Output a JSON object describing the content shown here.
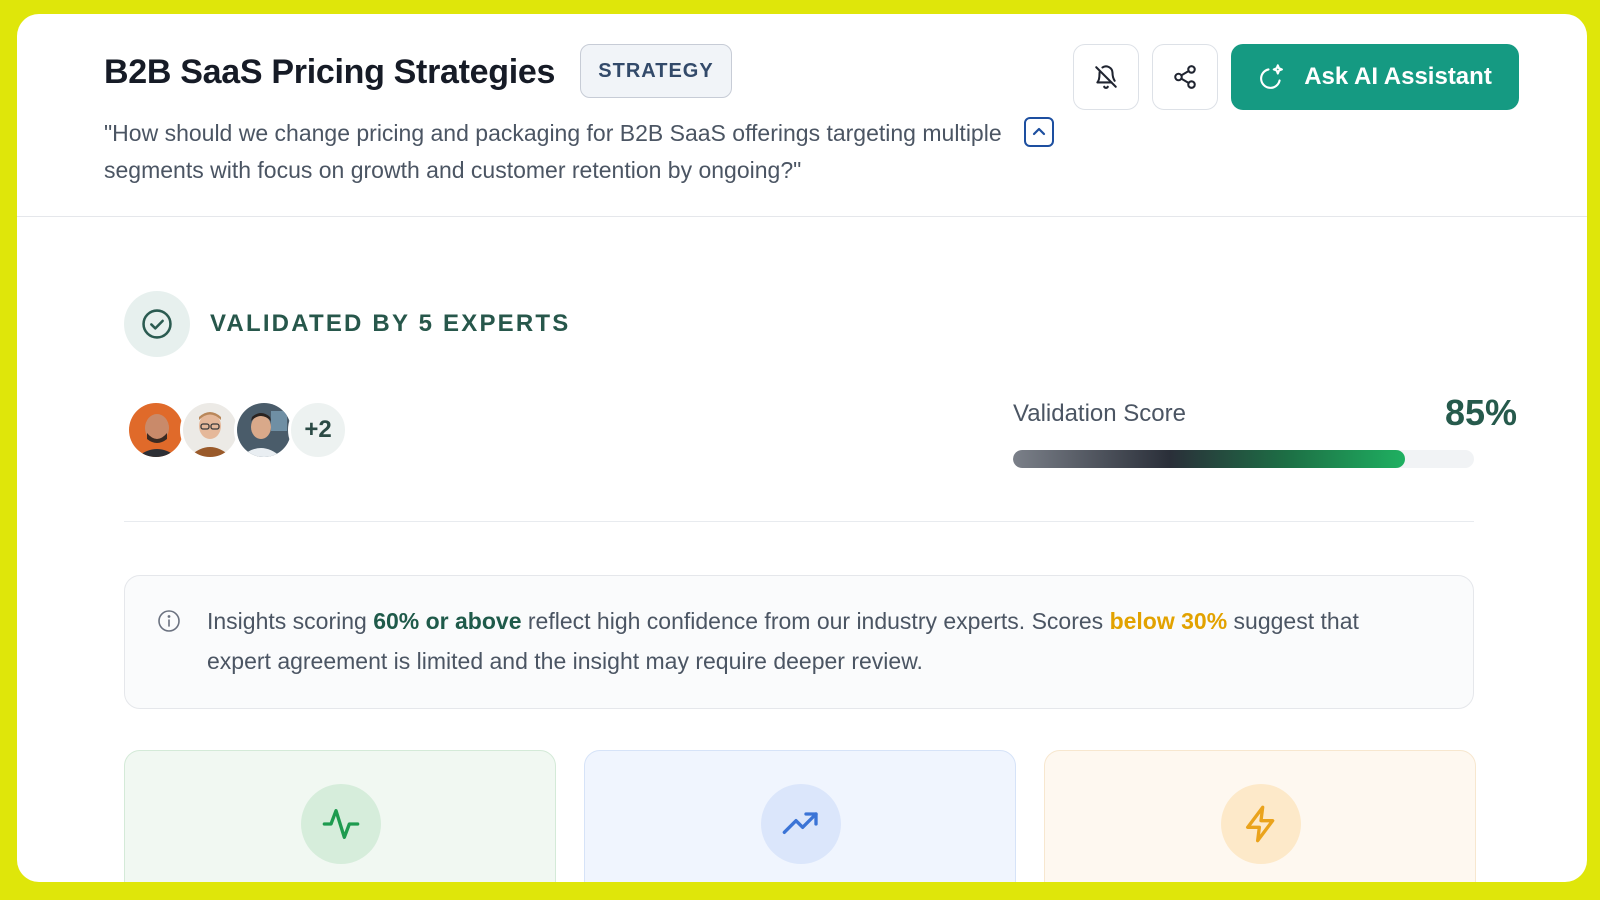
{
  "header": {
    "title": "B2B SaaS Pricing Strategies",
    "badge": "STRATEGY",
    "question": "\"How should we change pricing and packaging for B2B SaaS offerings targeting multiple segments with focus on growth and customer retention by ongoing?\"",
    "ask_button_label": "Ask AI Assistant",
    "icons": [
      "bell-off-icon",
      "share-icon",
      "sparkle-icon",
      "chevron-up-icon"
    ]
  },
  "validation": {
    "label": "VALIDATED BY 5 EXPERTS",
    "extra_experts": "+2",
    "score_label": "Validation Score",
    "score_value": "85%",
    "score_fraction": 0.85
  },
  "info": {
    "text_1": "Insights scoring ",
    "highlight_1": "60% or above",
    "text_2": " reflect high confidence from our industry experts. Scores ",
    "highlight_2": "below 30%",
    "text_3": " suggest that expert agreement is limited and the insight may require deeper review."
  },
  "cards": [
    {
      "icon": "activity-icon",
      "color": "#1e9b4f"
    },
    {
      "icon": "trending-up-icon",
      "color": "#3b74d6"
    },
    {
      "icon": "lightning-icon",
      "color": "#eaa31c"
    }
  ],
  "colors": {
    "accent": "#159a82",
    "frame": "#dfe60a",
    "score_green": "#265a4c",
    "warning": "#e2a200"
  }
}
